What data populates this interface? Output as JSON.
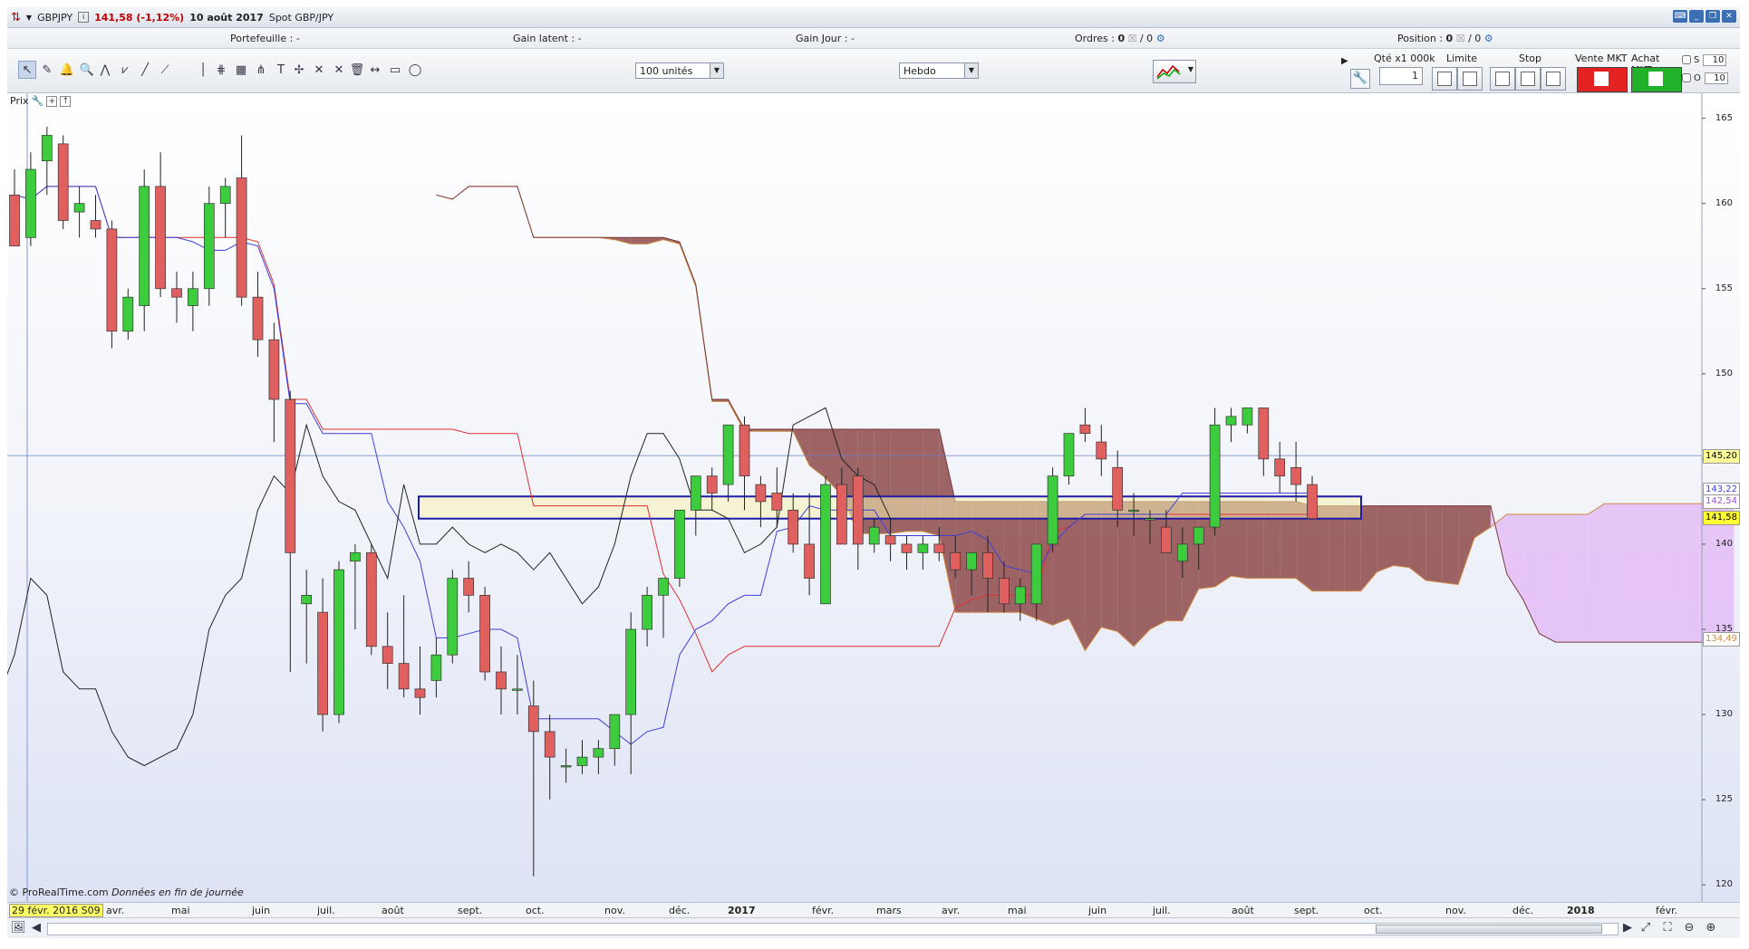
{
  "title": {
    "symbol": "GBPJPY",
    "price_change": "141,58 (-1,12%)",
    "date": "10 août 2017",
    "instrument": "Spot GBP/JPY"
  },
  "infobar": {
    "portefeuille": "Portefeuille : -",
    "gain_latent": "Gain latent : -",
    "gain_jour": "Gain Jour : -",
    "ordres_label": "Ordres :",
    "ordres_a": "0",
    "ordres_b": "/ 0",
    "position_label": "Position :",
    "position_a": "0",
    "position_b": "/ 0"
  },
  "toolbar": {
    "units_select": "100 unités",
    "period_select": "Hebdo",
    "qty_label": "Qté x1 000k",
    "qty_value": "1",
    "limit_label": "Limite",
    "stop_label": "Stop",
    "sell_label": "Vente MKT",
    "buy_label": "Achat MKT",
    "side_s_label": "S",
    "side_s_value": "10",
    "side_o_label": "O",
    "side_o_value": "10",
    "tools": [
      "pointer-icon",
      "ruler-icon",
      "alarm-icon",
      "zoom-icon",
      "indicator-icon",
      "trend-icon",
      "line-icon",
      "segment-icon",
      "vertical-line-icon",
      "fib-icon",
      "channel-icon",
      "pitchfork-icon",
      "text-icon",
      "tools-icon",
      "cross-icon",
      "cross2-icon",
      "trash-icon",
      "range-icon",
      "rectangle-icon",
      "ellipse-icon"
    ]
  },
  "chart": {
    "panel_label": "Prix",
    "credit": "© ProRealTime.com",
    "credit_italic": "Données en fin de journée",
    "price_ticks": [
      "165",
      "160",
      "155",
      "150",
      "145",
      "140",
      "135",
      "130",
      "125",
      "120"
    ],
    "price_labels": {
      "crosshair": "145,20",
      "purple1": "143,22",
      "purple2": "142,54",
      "last": "141,58",
      "orange": "134,49"
    },
    "time_labels": {
      "current": "29 févr. 2016 S09",
      "avr1": "avr.",
      "mai1": "mai",
      "juin1": "juin",
      "juil1": "juil.",
      "aout1": "août",
      "sept1": "sept.",
      "oct1": "oct.",
      "nov1": "nov.",
      "dec1": "déc.",
      "y2017": "2017",
      "fevr1": "févr.",
      "mars1": "mars",
      "avr2": "avr.",
      "mai2": "mai",
      "juin2": "juin",
      "juil2": "juil.",
      "aout2": "août",
      "sept2": "sept.",
      "oct2": "oct.",
      "nov2": "nov.",
      "dec2": "déc.",
      "y2018": "2018",
      "fevr2": "févr."
    },
    "colors": {
      "up": "#3dcc3d",
      "down": "#e06060",
      "tenkan": "#3f3fd8",
      "kijun": "#e03030",
      "chikou": "#222222",
      "cloud_bear": "#8e4a4a",
      "cloud_bull": "#e4b9f6",
      "zone": "#f7f2b5",
      "zone_border": "#1c1ca8"
    }
  },
  "chart_data": {
    "type": "candlestick",
    "symbol": "GBPJPY",
    "timeframe": "Hebdo",
    "ylim": [
      119,
      167
    ],
    "candles": [
      [
        160.5,
        162,
        159,
        157.5
      ],
      [
        158,
        163,
        157.5,
        162
      ],
      [
        162.5,
        164.5,
        160.5,
        164
      ],
      [
        163.5,
        164,
        158.5,
        159
      ],
      [
        159.5,
        161,
        158,
        160
      ],
      [
        159,
        160.5,
        158,
        158.5
      ],
      [
        158.5,
        159,
        151.5,
        152.5
      ],
      [
        152.5,
        155,
        152,
        154.5
      ],
      [
        154,
        162,
        152.5,
        161
      ],
      [
        161,
        163,
        154.5,
        155
      ],
      [
        155,
        156,
        153,
        154.5
      ],
      [
        154,
        156,
        152.5,
        155
      ],
      [
        155,
        161,
        154,
        160
      ],
      [
        160,
        161.5,
        158,
        161
      ],
      [
        161.5,
        164,
        154,
        154.5
      ],
      [
        154.5,
        156,
        151,
        152
      ],
      [
        152,
        153,
        146,
        148.5
      ],
      [
        148.5,
        149,
        132.5,
        139.5
      ],
      [
        136.5,
        138.5,
        133,
        137
      ],
      [
        136,
        138,
        129,
        130
      ],
      [
        130,
        139,
        129.5,
        138.5
      ],
      [
        139,
        140,
        135,
        139.5
      ],
      [
        139.5,
        140,
        133.5,
        134
      ],
      [
        134,
        136,
        131.5,
        133
      ],
      [
        133,
        137,
        131,
        131.5
      ],
      [
        131.5,
        134,
        130,
        131
      ],
      [
        132,
        134.5,
        131,
        133.5
      ],
      [
        133.5,
        138.5,
        133,
        138
      ],
      [
        138,
        139,
        136,
        137
      ],
      [
        137,
        137.5,
        132,
        132.5
      ],
      [
        132.5,
        134,
        130,
        131.5
      ],
      [
        131.5,
        133.5,
        130,
        131.5
      ],
      [
        130.5,
        132,
        120.5,
        129
      ],
      [
        129,
        130,
        125,
        127.5
      ],
      [
        127,
        128,
        126,
        127
      ],
      [
        127,
        128.5,
        126.5,
        127.5
      ],
      [
        127.5,
        128.5,
        126.5,
        128
      ],
      [
        128,
        130,
        127,
        130
      ],
      [
        130,
        136,
        126.5,
        135
      ],
      [
        135,
        137.5,
        134,
        137
      ],
      [
        137,
        138,
        134.5,
        138
      ],
      [
        138,
        142,
        137.5,
        142
      ],
      [
        142,
        144,
        140.5,
        144
      ],
      [
        144,
        144.5,
        142,
        143
      ],
      [
        143.5,
        146.5,
        142.5,
        147
      ],
      [
        147,
        147.5,
        142,
        144
      ],
      [
        143.5,
        144,
        141,
        142.5
      ],
      [
        143,
        144.5,
        141,
        142
      ],
      [
        142,
        143,
        139.5,
        140
      ],
      [
        140,
        143,
        137,
        138
      ],
      [
        136.5,
        144,
        136.5,
        143.5
      ],
      [
        143.5,
        144.5,
        140,
        140
      ],
      [
        144,
        144.5,
        138.5,
        140
      ],
      [
        140,
        141.5,
        139.5,
        141
      ],
      [
        140.5,
        141.5,
        139,
        140
      ],
      [
        140,
        140.5,
        138.5,
        139.5
      ],
      [
        139.5,
        140.5,
        138.5,
        140
      ],
      [
        140,
        141,
        139,
        139.5
      ],
      [
        139.5,
        140.5,
        138,
        138.5
      ],
      [
        138.5,
        139.5,
        137,
        139.5
      ],
      [
        139.5,
        140.5,
        136,
        138
      ],
      [
        138,
        139,
        136,
        136.5
      ],
      [
        136.5,
        138,
        135.5,
        137.5
      ],
      [
        136.5,
        140,
        135.5,
        140
      ],
      [
        140,
        144.5,
        139.5,
        144
      ],
      [
        144,
        146.5,
        143.5,
        146.5
      ],
      [
        147,
        148,
        146,
        146.5
      ],
      [
        146,
        147,
        144,
        145
      ],
      [
        144.5,
        145.5,
        141,
        142
      ],
      [
        142,
        143,
        140.5,
        142
      ],
      [
        141.5,
        142,
        140,
        141.5
      ],
      [
        141,
        142,
        139.5,
        139.5
      ],
      [
        139,
        141,
        138,
        140
      ],
      [
        140,
        141,
        138.5,
        141
      ],
      [
        141,
        148,
        140.5,
        147
      ],
      [
        147,
        148,
        146,
        147.5
      ],
      [
        147,
        148,
        146.5,
        148
      ],
      [
        148,
        148,
        144,
        145
      ],
      [
        145,
        146,
        143,
        144
      ],
      [
        144.5,
        146,
        142.5,
        143.5
      ],
      [
        143.5,
        144,
        141.5,
        141.5
      ]
    ],
    "series": [
      {
        "name": "Tenkan",
        "color": "#3f3fd8"
      },
      {
        "name": "Kijun",
        "color": "#e03030"
      },
      {
        "name": "Chikou",
        "color": "#222222"
      },
      {
        "name": "Kumo",
        "color": "#8e4a4a"
      }
    ],
    "annotations": {
      "zone_top": 142.8,
      "zone_bottom": 141.5,
      "crosshair_price": 145.2,
      "last_price": 141.58
    }
  }
}
